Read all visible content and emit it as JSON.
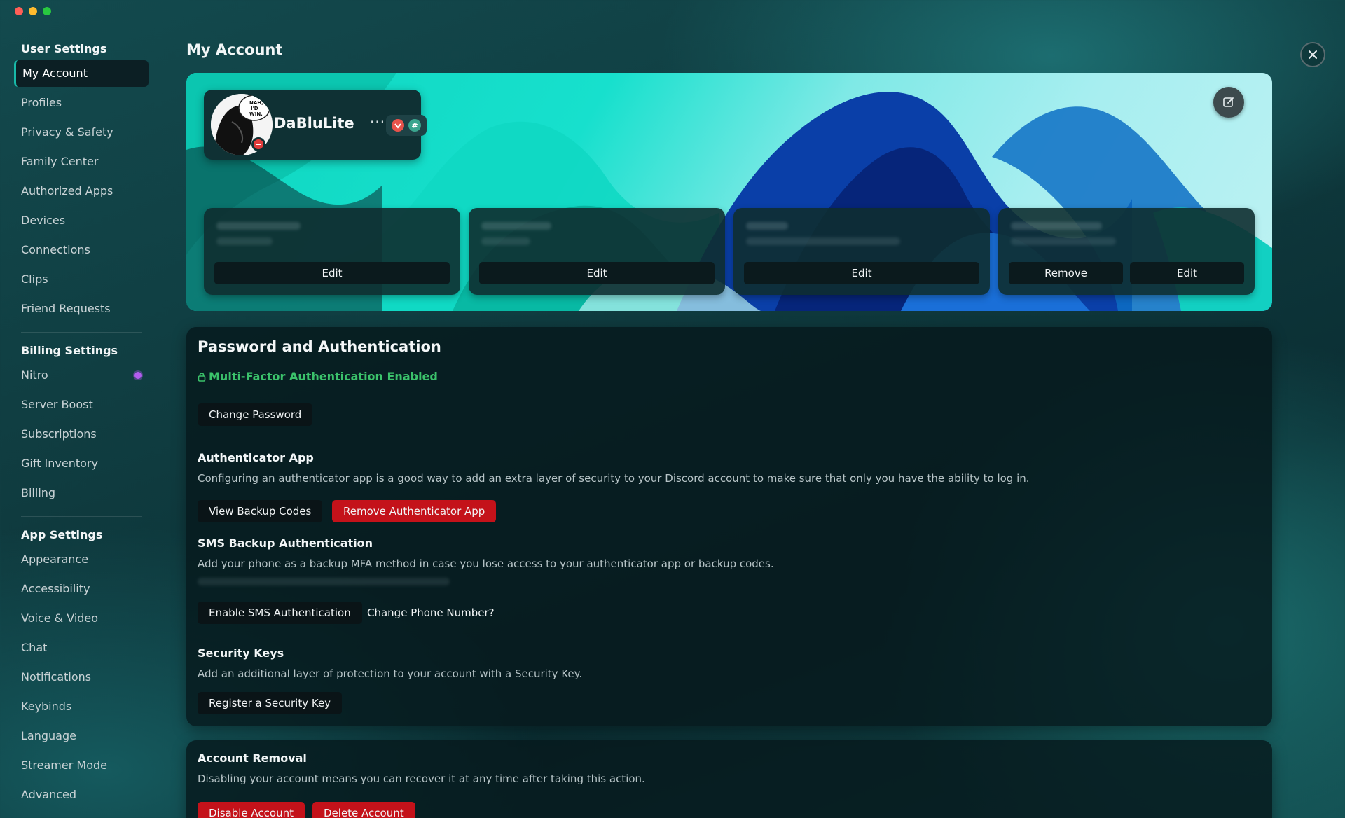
{
  "window": {
    "title": "My Account"
  },
  "sidebar": {
    "sections": [
      {
        "heading": "User Settings",
        "items": [
          "My Account",
          "Profiles",
          "Privacy & Safety",
          "Family Center",
          "Authorized Apps",
          "Devices",
          "Connections",
          "Clips",
          "Friend Requests"
        ]
      },
      {
        "heading": "Billing Settings",
        "items": [
          "Nitro",
          "Server Boost",
          "Subscriptions",
          "Gift Inventory",
          "Billing"
        ]
      },
      {
        "heading": "App Settings",
        "items": [
          "Appearance",
          "Accessibility",
          "Voice & Video",
          "Chat",
          "Notifications",
          "Keybinds",
          "Language",
          "Streamer Mode",
          "Advanced"
        ]
      }
    ],
    "active_item": "My Account"
  },
  "profile": {
    "username": "DaBluLite",
    "more_label": "···",
    "avatar_text": "NAH, I'D WIN.",
    "status_color": "#e03b3b",
    "badges": [
      "shield-badge-icon",
      "hashtag-badge-icon"
    ]
  },
  "info_cards": [
    {
      "buttons": [
        "Edit"
      ]
    },
    {
      "buttons": [
        "Edit"
      ]
    },
    {
      "buttons": [
        "Edit"
      ]
    },
    {
      "buttons": [
        "Remove",
        "Edit"
      ]
    }
  ],
  "password_auth": {
    "title": "Password and Authentication",
    "mfa_status": "Multi-Factor Authentication Enabled",
    "mfa_color": "#3bc26b",
    "change_password": "Change Password",
    "authenticator": {
      "title": "Authenticator App",
      "description": "Configuring an authenticator app is a good way to add an extra layer of security to your Discord account to make sure that only you have the ability to log in.",
      "view_backup": "View Backup Codes",
      "remove_app": "Remove Authenticator App"
    },
    "sms": {
      "title": "SMS Backup Authentication",
      "description": "Add your phone as a backup MFA method in case you lose access to your authenticator app or backup codes.",
      "enable": "Enable SMS Authentication",
      "change_phone": "Change Phone Number?"
    },
    "security_keys": {
      "title": "Security Keys",
      "description": "Add an additional layer of protection to your account with a Security Key.",
      "register": "Register a Security Key"
    }
  },
  "account_removal": {
    "title": "Account Removal",
    "description": "Disabling your account means you can recover it at any time after taking this action.",
    "disable": "Disable Account",
    "delete": "Delete Account"
  },
  "colors": {
    "accent": "#18b9a8",
    "danger": "#c4121a",
    "nitro": "#b35cf0"
  }
}
